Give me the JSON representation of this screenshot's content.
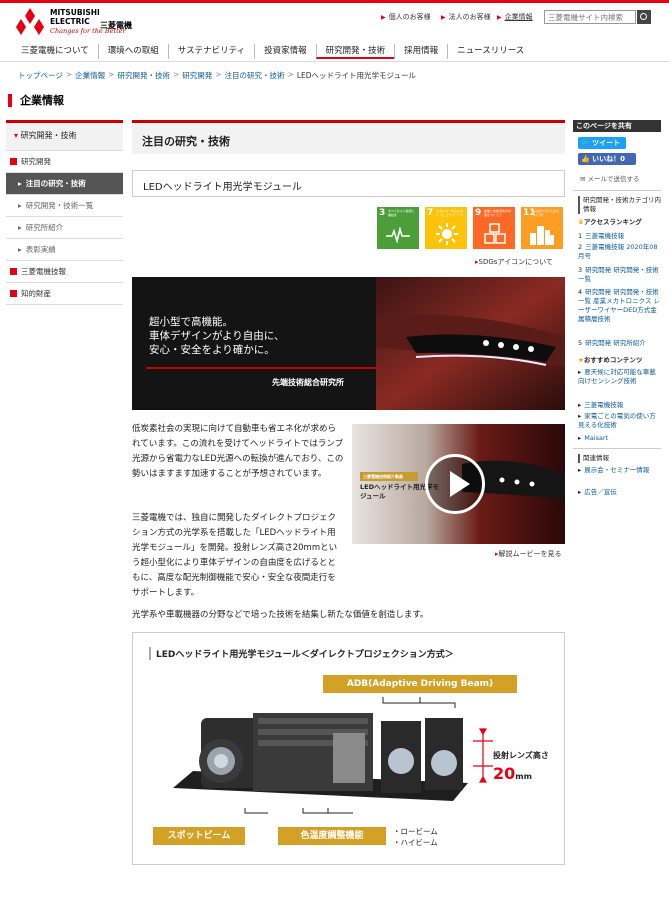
{
  "header": {
    "logo_line1": "MITSUBISHI",
    "logo_line2": "ELECTRIC",
    "logo_tagline": "Changes for the Better",
    "logo_jp": "三菱電機",
    "util_links": [
      "個人のお客様",
      "法人のお客様",
      "企業情報"
    ],
    "search_placeholder": "三菱電機サイト内検索"
  },
  "gnav": [
    "三菱電機について",
    "環境への取組",
    "サステナビリティ",
    "投資家情報",
    "研究開発・技術",
    "採用情報",
    "ニュースリリース"
  ],
  "breadcrumb": [
    "トップページ",
    "企業情報",
    "研究開発・技術",
    "研究開発",
    "注目の研究・技術",
    "LEDヘッドライト用光学モジュール"
  ],
  "section_title": "企業情報",
  "sidenav": {
    "head": "研究開発・技術",
    "items": [
      {
        "label": "研究開発",
        "type": "cat"
      },
      {
        "label": "注目の研究・技術",
        "type": "cur"
      },
      {
        "label": "研究開発・技術一覧",
        "type": "sub"
      },
      {
        "label": "研究所紹介",
        "type": "sub"
      },
      {
        "label": "表彰実績",
        "type": "sub"
      },
      {
        "label": "三菱電機技報",
        "type": "cat"
      },
      {
        "label": "知的財産",
        "type": "cat"
      }
    ]
  },
  "main": {
    "heading": "注目の研究・技術",
    "subheading": "LEDヘッドライト用光学モジュール",
    "sdgs": [
      {
        "num": "3",
        "label": "すべての人に健康と福祉を",
        "color": "#4c9f38"
      },
      {
        "num": "7",
        "label": "エネルギーをみんなに そしてクリーンに",
        "color": "#fcc30b"
      },
      {
        "num": "9",
        "label": "産業と技術革新の基盤をつくろう",
        "color": "#fd6925"
      },
      {
        "num": "11",
        "label": "住み続けられるまちづくりを",
        "color": "#fd9d24"
      }
    ],
    "sdg_link": "SDGsアイコンについて",
    "hero_line1": "超小型で高機能。",
    "hero_line2": "車体デザインがより自由に、",
    "hero_line3": "安心・安全をより確かに。",
    "hero_org": "先端技術総合研究所",
    "para1": "低炭素社会の実現に向けて自動車も省エネ化が求められています。この流れを受けてヘッドライトではランプ光源から省電力なLED光源への転換が進んでおり、この勢いはますます加速することが予想されています。",
    "para2": "三菱電機では、独自に開発したダイレクトプロジェクション方式の光学系を搭載した「LEDヘッドライト用光学モジュール」を開発。投射レンズ高さ20mmという超小型化により車体デザインの自由度を広げるとともに、高度な配光制御機能で安心・安全な夜間走行をサポートします。",
    "para3": "光学系や車載機器の分野などで培った技術を結集し新たな価値を創造します。",
    "video_tag": "三菱電機技術紹介動画",
    "video_title": "LEDヘッドライト用光学モジュール",
    "video_link": "解説ムービーを見る",
    "diagram": {
      "title": "LEDヘッドライト用光学モジュール＜ダイレクトプロジェクション方式＞",
      "adb": "ADB(Adaptive Driving Beam)",
      "lens_label": "投射レンズ高さ",
      "lens_value": "20",
      "lens_unit": "mm",
      "spot": "スポットビーム",
      "color_temp": "色温度調整機能",
      "low": "・ロービーム",
      "high": "・ハイビーム"
    }
  },
  "right": {
    "share_title": "このページを共有",
    "tweet": "ツイート",
    "like": "いいね！0",
    "mail": "メールで送信する",
    "ranking_cat": "研究開発・技術カテゴリ内情報",
    "ranking_title": "アクセスランキング",
    "ranking": [
      "三菱電機技報",
      "三菱電機技報 2020年08月号",
      "研究開発 研究開発・技術一覧",
      "研究開発 研究開発・技術一覧 産業メカトロニクス レーザーワイヤーDED方式金属積層技術",
      "研究開発 研究所紹介"
    ],
    "recommend_title": "おすすめコンテンツ",
    "recommend": [
      "悪天候に対応可能な車載向けセンシング技術",
      "三菱電機技報",
      "家電ごとの電気の使い方見える化技術",
      "Maisart"
    ],
    "related_title": "関連情報",
    "related": [
      "展示会・セミナー情報",
      "広告／宣伝"
    ]
  }
}
